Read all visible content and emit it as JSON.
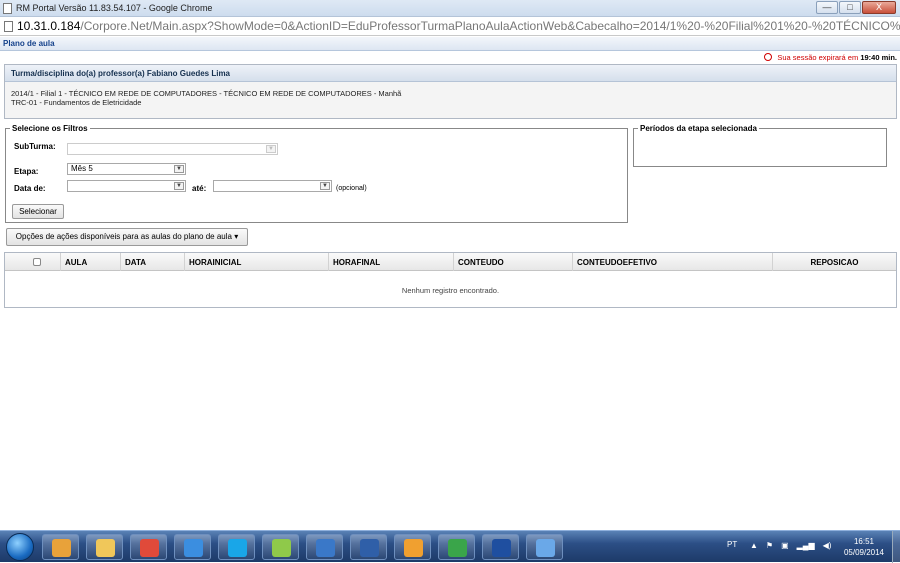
{
  "window": {
    "title": "RM Portal Versão 11.83.54.107 - Google Chrome",
    "minimize": "—",
    "maximize": "□",
    "close": "X"
  },
  "address": {
    "host": "10.31.0.184",
    "path": "/Corpore.Net/Main.aspx?ShowMode=0&ActionID=EduProfessorTurmaPlanoAulaActionWeb&Cabecalho=2014/1%20-%20Filial%201%20-%20TÉCNICO%20EM%20RED"
  },
  "page": {
    "title": "Plano de aula",
    "session_prefix": "Sua sessão expirará em",
    "session_time": "19:40 min."
  },
  "turma": {
    "header": "Turma/disciplina do(a) professor(a) Fabiano Guedes Lima",
    "line1": "2014/1 - Filial 1 - TÉCNICO EM REDE DE COMPUTADORES - TÉCNICO EM REDE DE COMPUTADORES - Manhã",
    "line2": "TRC-01 - Fundamentos de Eletricidade"
  },
  "filters": {
    "legend": "Selecione os Filtros",
    "subturma_label": "SubTurma:",
    "subturma_value": "",
    "etapa_label": "Etapa:",
    "etapa_value": "Mês 5",
    "data_de_label": "Data de:",
    "data_de_value": "",
    "ate_label": "até:",
    "ate_value": "",
    "opcional": "(opcional)",
    "select_button": "Selecionar"
  },
  "periods": {
    "legend": "Períodos da etapa selecionada"
  },
  "actions": {
    "label": "Opções de ações disponíveis para as aulas do plano de aula"
  },
  "grid": {
    "columns": [
      "AULA",
      "DATA",
      "HORAINICIAL",
      "HORAFINAL",
      "CONTEUDO",
      "CONTEUDOEFETIVO",
      "REPOSICAO"
    ],
    "empty_message": "Nenhum registro encontrado."
  },
  "taskbar": {
    "language": "PT",
    "time": "16:51",
    "date": "05/09/2014",
    "apps": [
      {
        "name": "outlook",
        "color": "#e8a23a"
      },
      {
        "name": "explorer",
        "color": "#f0c75a"
      },
      {
        "name": "chrome",
        "color": "#e04a3a"
      },
      {
        "name": "internet-explorer",
        "color": "#3b8ee0"
      },
      {
        "name": "skype",
        "color": "#19a6e8"
      },
      {
        "name": "network-folder",
        "color": "#8fc94a"
      },
      {
        "name": "lync",
        "color": "#3a78c8"
      },
      {
        "name": "word",
        "color": "#2f5fa8"
      },
      {
        "name": "pdf-tool",
        "color": "#f0a030"
      },
      {
        "name": "green-app",
        "color": "#3aa54a"
      },
      {
        "name": "blue-circle-app",
        "color": "#1f4fa0"
      },
      {
        "name": "image-tool",
        "color": "#6aa8e8"
      }
    ]
  }
}
